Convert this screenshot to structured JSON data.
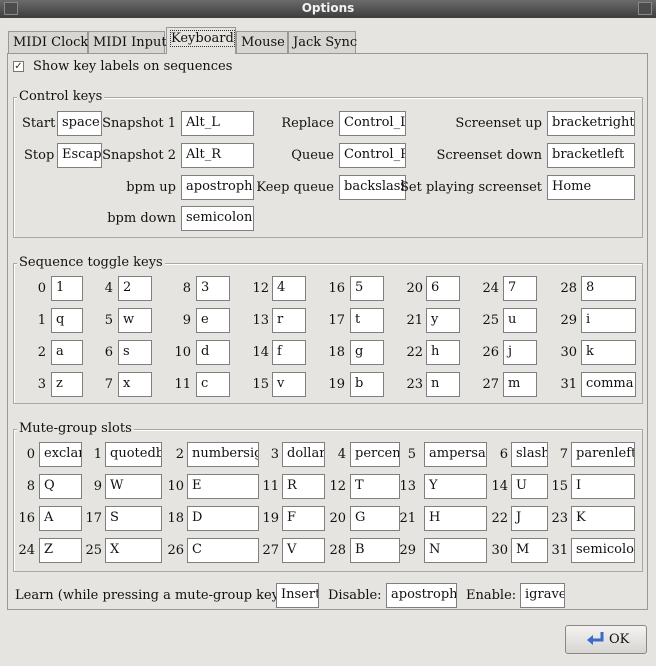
{
  "window": {
    "title": "Options"
  },
  "tabs": [
    "MIDI Clock",
    "MIDI Input",
    "Keyboard",
    "Mouse",
    "Jack Sync"
  ],
  "show_key_labels": {
    "label": "Show key labels on sequences",
    "checked": true
  },
  "control_keys": {
    "title": "Control keys",
    "start": {
      "label": "Start",
      "value": "space"
    },
    "stop": {
      "label": "Stop",
      "value": "Escape"
    },
    "snapshot1": {
      "label": "Snapshot 1",
      "value": "Alt_L"
    },
    "snapshot2": {
      "label": "Snapshot 2",
      "value": "Alt_R"
    },
    "bpm_up": {
      "label": "bpm up",
      "value": "apostrophe"
    },
    "bpm_down": {
      "label": "bpm down",
      "value": "semicolon"
    },
    "replace": {
      "label": "Replace",
      "value": "Control_L"
    },
    "queue": {
      "label": "Queue",
      "value": "Control_R"
    },
    "keep_queue": {
      "label": "Keep queue",
      "value": "backslash"
    },
    "screenset_up": {
      "label": "Screenset up",
      "value": "bracketright"
    },
    "screenset_down": {
      "label": "Screenset down",
      "value": "bracketleft"
    },
    "set_playing": {
      "label": "Set playing screenset",
      "value": "Home"
    }
  },
  "sequence_toggle": {
    "title": "Sequence toggle keys",
    "items": [
      {
        "num": "0",
        "value": "1"
      },
      {
        "num": "4",
        "value": "2"
      },
      {
        "num": "8",
        "value": "3"
      },
      {
        "num": "12",
        "value": "4"
      },
      {
        "num": "16",
        "value": "5"
      },
      {
        "num": "20",
        "value": "6"
      },
      {
        "num": "24",
        "value": "7"
      },
      {
        "num": "28",
        "value": "8"
      },
      {
        "num": "1",
        "value": "q"
      },
      {
        "num": "5",
        "value": "w"
      },
      {
        "num": "9",
        "value": "e"
      },
      {
        "num": "13",
        "value": "r"
      },
      {
        "num": "17",
        "value": "t"
      },
      {
        "num": "21",
        "value": "y"
      },
      {
        "num": "25",
        "value": "u"
      },
      {
        "num": "29",
        "value": "i"
      },
      {
        "num": "2",
        "value": "a"
      },
      {
        "num": "6",
        "value": "s"
      },
      {
        "num": "10",
        "value": "d"
      },
      {
        "num": "14",
        "value": "f"
      },
      {
        "num": "18",
        "value": "g"
      },
      {
        "num": "22",
        "value": "h"
      },
      {
        "num": "26",
        "value": "j"
      },
      {
        "num": "30",
        "value": "k"
      },
      {
        "num": "3",
        "value": "z"
      },
      {
        "num": "7",
        "value": "x"
      },
      {
        "num": "11",
        "value": "c"
      },
      {
        "num": "15",
        "value": "v"
      },
      {
        "num": "19",
        "value": "b"
      },
      {
        "num": "23",
        "value": "n"
      },
      {
        "num": "27",
        "value": "m"
      },
      {
        "num": "31",
        "value": "comma"
      }
    ]
  },
  "mute_group": {
    "title": "Mute-group slots",
    "items": [
      {
        "num": "0",
        "value": "exclam"
      },
      {
        "num": "1",
        "value": "quotedbl"
      },
      {
        "num": "2",
        "value": "numbersign"
      },
      {
        "num": "3",
        "value": "dollar"
      },
      {
        "num": "4",
        "value": "percent"
      },
      {
        "num": "5",
        "value": "ampersand"
      },
      {
        "num": "6",
        "value": "slash"
      },
      {
        "num": "7",
        "value": "parenleft"
      },
      {
        "num": "8",
        "value": "Q"
      },
      {
        "num": "9",
        "value": "W"
      },
      {
        "num": "10",
        "value": "E"
      },
      {
        "num": "11",
        "value": "R"
      },
      {
        "num": "12",
        "value": "T"
      },
      {
        "num": "13",
        "value": "Y"
      },
      {
        "num": "14",
        "value": "U"
      },
      {
        "num": "15",
        "value": "I"
      },
      {
        "num": "16",
        "value": "A"
      },
      {
        "num": "17",
        "value": "S"
      },
      {
        "num": "18",
        "value": "D"
      },
      {
        "num": "19",
        "value": "F"
      },
      {
        "num": "20",
        "value": "G"
      },
      {
        "num": "21",
        "value": "H"
      },
      {
        "num": "22",
        "value": "J"
      },
      {
        "num": "23",
        "value": "K"
      },
      {
        "num": "24",
        "value": "Z"
      },
      {
        "num": "25",
        "value": "X"
      },
      {
        "num": "26",
        "value": "C"
      },
      {
        "num": "27",
        "value": "V"
      },
      {
        "num": "28",
        "value": "B"
      },
      {
        "num": "29",
        "value": "N"
      },
      {
        "num": "30",
        "value": "M"
      },
      {
        "num": "31",
        "value": "semicolon"
      }
    ]
  },
  "learn": {
    "label": "Learn (while pressing a mute-group key):",
    "value": "Insert"
  },
  "disable": {
    "label": "Disable:",
    "value": "apostrophe"
  },
  "enable": {
    "label": "Enable:",
    "value": "igrave"
  },
  "ok_button": {
    "label": "OK"
  }
}
